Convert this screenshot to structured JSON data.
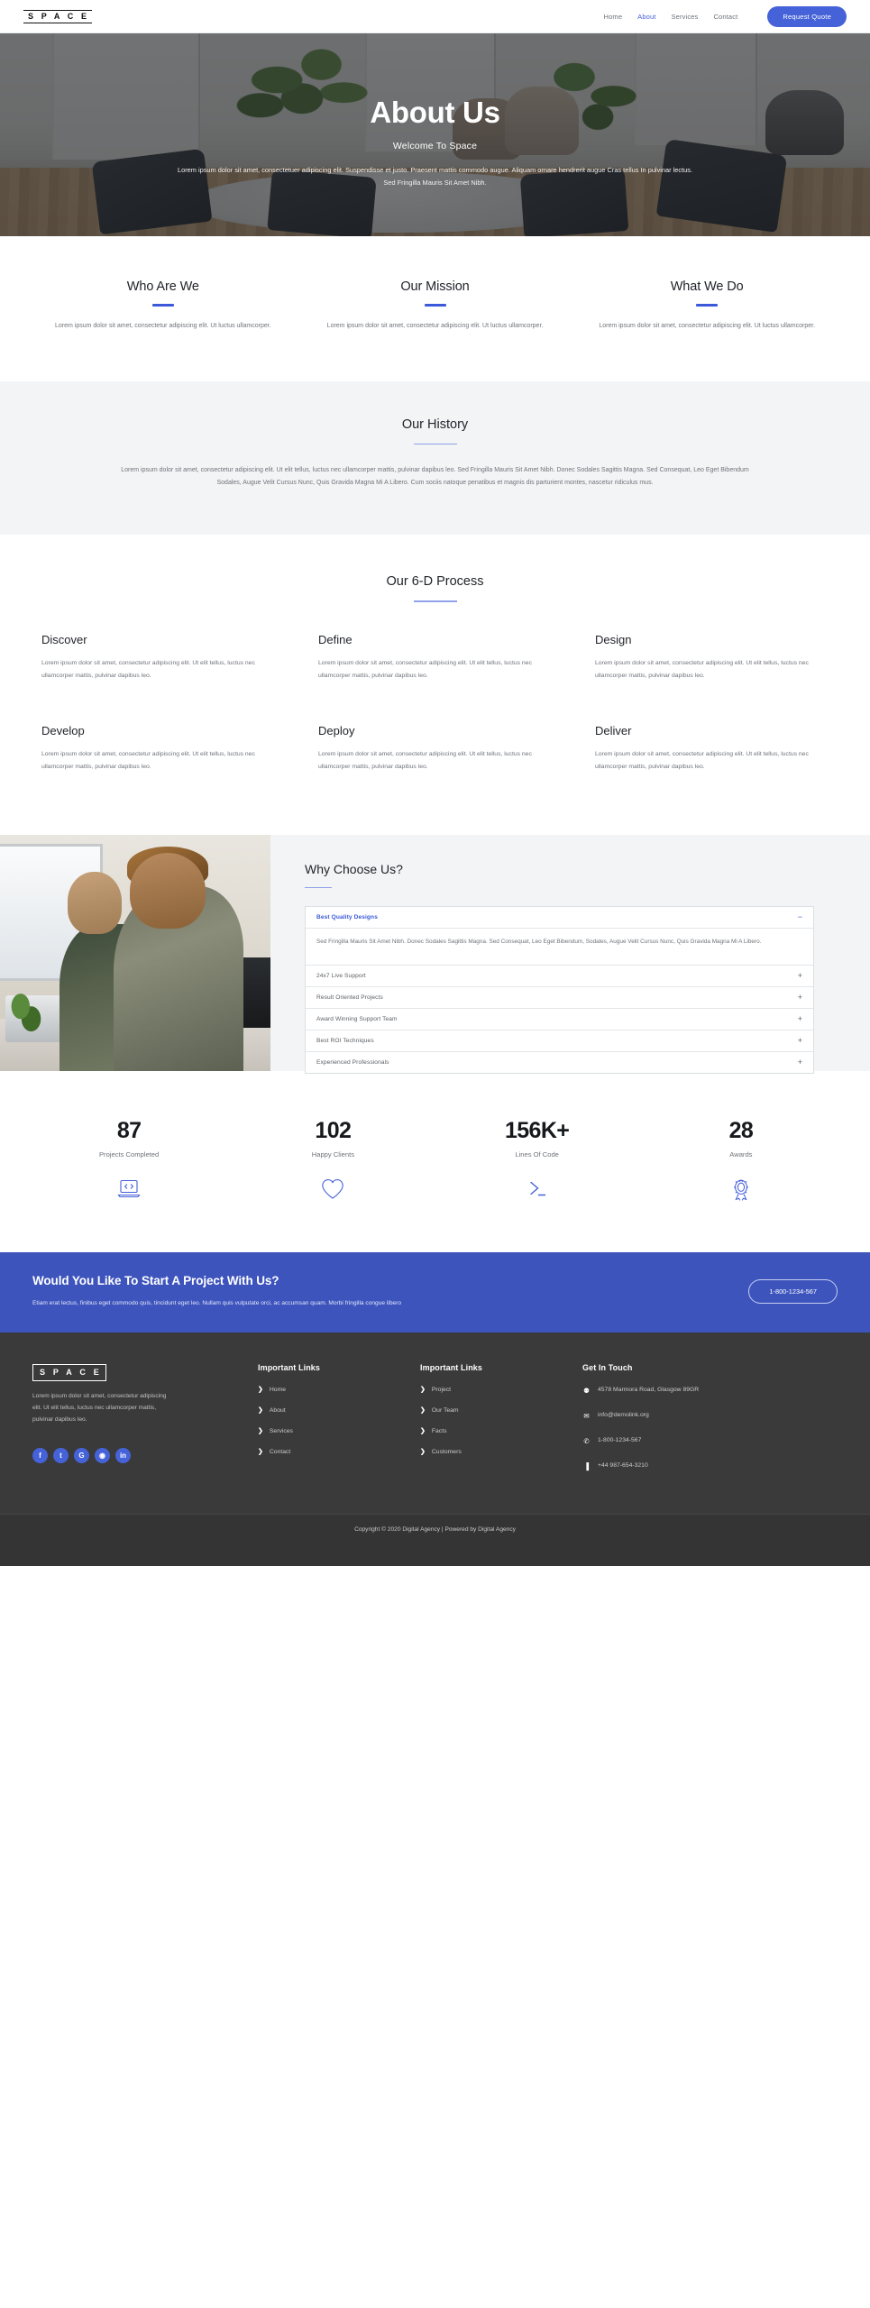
{
  "nav": {
    "logo": "S P A C E",
    "links": [
      {
        "label": "Home",
        "active": false
      },
      {
        "label": "About",
        "active": true
      },
      {
        "label": "Services",
        "active": false
      },
      {
        "label": "Contact",
        "active": false
      }
    ],
    "cta_label": "Request Quote"
  },
  "hero": {
    "title": "About Us",
    "subtitle": "Welcome To Space",
    "description": "Lorem ipsum dolor sit amet, consectetuer adipiscing elit. Suspendisse et justo. Praesent mattis commodo augue. Aliquam ornare hendrerit augue Cras tellus In pulvinar lectus. Sed Fringilla Mauris Sit Amet Nibh."
  },
  "three_col": [
    {
      "title": "Who Are We",
      "text": "Lorem ipsum dolor sit amet, consectetur adipiscing elit. Ut  luctus ullamcorper."
    },
    {
      "title": "Our Mission",
      "text": "Lorem ipsum dolor sit amet, consectetur adipiscing elit. Ut  luctus ullamcorper."
    },
    {
      "title": "What We Do",
      "text": "Lorem ipsum dolor sit amet, consectetur adipiscing elit. Ut  luctus ullamcorper."
    }
  ],
  "history": {
    "title": "Our History",
    "text": "Lorem ipsum dolor sit amet, consectetur adipiscing elit. Ut elit tellus, luctus nec ullamcorper mattis, pulvinar dapibus leo. Sed Fringilla Mauris Sit Amet Nibh. Donec Sodales Sagittis Magna. Sed Consequat, Leo Eget Bibendum Sodales, Augue Velit Cursus Nunc, Quis Gravida Magna Mi A Libero. Cum sociis natoque penatibus et magnis dis parturient montes, nascetur ridiculus mus."
  },
  "process": {
    "title": "Our 6-D Process",
    "items": [
      {
        "title": "Discover",
        "text": "Lorem ipsum dolor sit amet, consectetur adipiscing elit. Ut elit tellus, luctus nec ullamcorper mattis, pulvinar dapibus leo."
      },
      {
        "title": "Define",
        "text": "Lorem ipsum dolor sit amet, consectetur adipiscing elit. Ut elit tellus, luctus nec ullamcorper mattis, pulvinar dapibus leo."
      },
      {
        "title": "Design",
        "text": "Lorem ipsum dolor sit amet, consectetur adipiscing elit. Ut elit tellus, luctus nec ullamcorper mattis, pulvinar dapibus leo."
      },
      {
        "title": "Develop",
        "text": "Lorem ipsum dolor sit amet, consectetur adipiscing elit. Ut elit tellus, luctus nec ullamcorper mattis, pulvinar dapibus leo."
      },
      {
        "title": "Deploy",
        "text": "Lorem ipsum dolor sit amet, consectetur adipiscing elit. Ut elit tellus, luctus nec ullamcorper mattis, pulvinar dapibus leo."
      },
      {
        "title": "Deliver",
        "text": "Lorem ipsum dolor sit amet, consectetur adipiscing elit. Ut elit tellus, luctus nec ullamcorper mattis, pulvinar dapibus leo."
      }
    ]
  },
  "why": {
    "title": "Why Choose Us?",
    "open_item": {
      "label": "Best Quality Designs",
      "sign": "−",
      "body": "Sed Fringilla Mauris Sit Amet Nibh. Donec Sodales Sagittis Magna. Sed Consequat, Leo Eget Bibendum, Sodales, Augue Velit Cursus Nunc, Quis Gravida Magna Mi A Libero."
    },
    "items": [
      {
        "label": "24x7 Live Support",
        "sign": "+"
      },
      {
        "label": "Result Oriented Projects",
        "sign": "+"
      },
      {
        "label": "Award Winning Support Team",
        "sign": "+"
      },
      {
        "label": "Best ROI Techniques",
        "sign": "+"
      },
      {
        "label": "Experienced Professionals",
        "sign": "+"
      }
    ]
  },
  "stats": [
    {
      "number": "87",
      "label": "Projects Completed",
      "icon": "laptop-code-icon"
    },
    {
      "number": "102",
      "label": "Happy Clients",
      "icon": "heart-icon"
    },
    {
      "number": "156K+",
      "label": "Lines Of Code",
      "icon": "terminal-icon"
    },
    {
      "number": "28",
      "label": "Awards",
      "icon": "award-medal-icon"
    }
  ],
  "cta": {
    "title": "Would You Like To Start A Project With Us?",
    "text": "Etiam erat lectus, finibus eget commodo quis, tincidunt eget leo. Nullam quis vulputate orci, ac accumsan quam. Morbi fringilla congue libero",
    "button": "1-800-1234-567"
  },
  "footer": {
    "logo": "S P A C E",
    "about": "Lorem ipsum dolor sit amet, consectetur adipiscing elit. Ut elit tellus, luctus nec ullamcorper mattis, pulvinar dapibus leo.",
    "socials": [
      {
        "name": "facebook-icon",
        "glyph": "f"
      },
      {
        "name": "twitter-icon",
        "glyph": "t"
      },
      {
        "name": "google-plus-icon",
        "glyph": "G"
      },
      {
        "name": "instagram-icon",
        "glyph": "◉"
      },
      {
        "name": "linkedin-icon",
        "glyph": "in"
      }
    ],
    "links_col1": {
      "title": "Important Links",
      "items": [
        "Home",
        "About",
        "Services",
        "Contact"
      ]
    },
    "links_col2": {
      "title": "Important Links",
      "items": [
        "Project",
        "Our Team",
        "Facts",
        "Customers"
      ]
    },
    "touch": {
      "title": "Get In Touch",
      "items": [
        {
          "icon": "location-pin-icon",
          "glyph": "⚉",
          "text": "4578 Marmora Road, Glasgow 89GR"
        },
        {
          "icon": "envelope-icon",
          "glyph": "✉",
          "text": "info@demolink.org"
        },
        {
          "icon": "phone-icon",
          "glyph": "✆",
          "text": "1-800-1234-567"
        },
        {
          "icon": "mobile-icon",
          "glyph": "▐",
          "text": "+44 987-654-3210"
        }
      ]
    },
    "copyright": "Copyright © 2020 Digital Agency | Powered by Digital Agency"
  },
  "colors": {
    "accent": "#4562d8",
    "cta_bg": "#3d54bd",
    "footer_bg": "#3a3a3a",
    "history_bg": "#f3f4f6"
  }
}
